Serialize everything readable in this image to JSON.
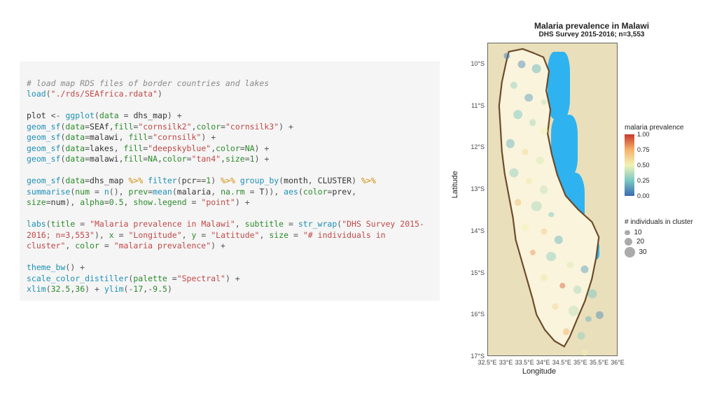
{
  "code": {
    "comment1": "# load map RDS files of border countries and lakes",
    "load_path": "\"./rds/SEAfrica.rdata\"",
    "lines": {
      "l1": "load",
      "l2_plot": "plot",
      "l2_gg": "ggplot",
      "l2_data": "data",
      "l2_dhs": "dhs_map",
      "geom_sf": "geom_sf",
      "data_arg": "data",
      "fill_arg": "fill",
      "color_arg": "color",
      "size_arg": "size",
      "v_SEAf": "SEAf",
      "v_malawi": "malawi",
      "v_lakes": "lakes",
      "s_cornsilk2": "\"cornsilk2\"",
      "s_cornsilk3": "\"cornsilk3\"",
      "s_cornsilk": "\"cornsilk\"",
      "s_deepskyblue": "\"deepskyblue\"",
      "s_tan4": "\"tan4\"",
      "na": "NA",
      "num1": "1",
      "pipe": "%>%",
      "filter": "filter",
      "pcr": "pcr",
      "eq1": "1",
      "group_by": "group_by",
      "month": "month",
      "cluster": "CLUSTER",
      "summarise": "summarise",
      "num_eq": "num",
      "n_fn": "n",
      "prev": "prev",
      "mean": "mean",
      "malaria": "malaria",
      "narm": "na.rm",
      "T": "T",
      "aes": "aes",
      "colorprev": "color",
      "sizeeq": "size",
      "alpha": "alpha",
      "alpha_v": "0.5",
      "showlegend": "show.legend",
      "point": "\"point\"",
      "labs": "labs",
      "title_arg": "title",
      "title_str": "\"Malaria prevalence in Malawi\"",
      "subtitle_arg": "subtitle",
      "str_wrap": "str_wrap",
      "subtitle_str": "\"DHS Survey 2015-2016; n=3,553\"",
      "x_arg": "x",
      "x_str": "\"Longitude\"",
      "y_arg": "y",
      "y_str": "\"Latitude\"",
      "size_lab": "\"# individuals in cluster\"",
      "color_lab": "\"malaria prevalence\"",
      "theme_bw": "theme_bw",
      "scale_color": "scale_color_distiller",
      "palette": "palette",
      "spectral": "\"Spectral\"",
      "xlim": "xlim",
      "xlim_a": "32.5",
      "xlim_b": "36",
      "ylim": "ylim",
      "ylim_a": "-17",
      "ylim_b": "-9.5"
    }
  },
  "chart_data": {
    "type": "map",
    "title": "Malaria prevalence in Malawi",
    "subtitle": "DHS Survey 2015-2016; n=3,553",
    "xlabel": "Longitude",
    "ylabel": "Latitude",
    "xlim": [
      32.5,
      36.0
    ],
    "ylim": [
      -17.0,
      -9.5
    ],
    "xticks": [
      "32.5°E",
      "33°E",
      "33.5°E",
      "34°E",
      "34.5°E",
      "35°E",
      "35.5°E",
      "36°E"
    ],
    "yticks": [
      "10°S",
      "11°S",
      "12°S",
      "13°S",
      "14°S",
      "15°S",
      "16°S",
      "17°S"
    ],
    "color_legend": {
      "title": "malaria prevalence",
      "breaks": [
        0.0,
        0.25,
        0.5,
        0.75,
        1.0
      ],
      "palette": "Spectral"
    },
    "size_legend": {
      "title": "# individuals in cluster",
      "breaks": [
        10,
        20,
        30
      ]
    },
    "lake_rects": [
      {
        "x": 34.1,
        "y": -9.7,
        "w": 0.6,
        "h": 1.6
      },
      {
        "x": 34.2,
        "y": -11.2,
        "w": 0.7,
        "h": 1.5
      },
      {
        "x": 34.3,
        "y": -12.6,
        "w": 0.8,
        "h": 1.6
      },
      {
        "x": 34.5,
        "y": -14.0,
        "w": 0.7,
        "h": 0.8
      },
      {
        "x": 34.9,
        "y": -14.2,
        "w": 0.6,
        "h": 0.5
      }
    ],
    "points": [
      {
        "lon": 33.0,
        "lat": -9.8,
        "prev": 0.05,
        "n": 15
      },
      {
        "lon": 33.4,
        "lat": -10.0,
        "prev": 0.1,
        "n": 20
      },
      {
        "lon": 33.8,
        "lat": -10.1,
        "prev": 0.2,
        "n": 25
      },
      {
        "lon": 33.2,
        "lat": -10.5,
        "prev": 0.3,
        "n": 18
      },
      {
        "lon": 33.6,
        "lat": -10.8,
        "prev": 0.15,
        "n": 22
      },
      {
        "lon": 34.0,
        "lat": -10.9,
        "prev": 0.4,
        "n": 12
      },
      {
        "lon": 33.3,
        "lat": -11.2,
        "prev": 0.25,
        "n": 28
      },
      {
        "lon": 33.7,
        "lat": -11.4,
        "prev": 0.35,
        "n": 16
      },
      {
        "lon": 34.0,
        "lat": -11.6,
        "prev": 0.5,
        "n": 20
      },
      {
        "lon": 33.1,
        "lat": -11.9,
        "prev": 0.2,
        "n": 24
      },
      {
        "lon": 33.5,
        "lat": -12.1,
        "prev": 0.6,
        "n": 14
      },
      {
        "lon": 33.9,
        "lat": -12.3,
        "prev": 0.45,
        "n": 18
      },
      {
        "lon": 33.2,
        "lat": -12.6,
        "prev": 0.3,
        "n": 26
      },
      {
        "lon": 33.6,
        "lat": -12.8,
        "prev": 0.55,
        "n": 12
      },
      {
        "lon": 34.0,
        "lat": -13.0,
        "prev": 0.4,
        "n": 22
      },
      {
        "lon": 33.3,
        "lat": -13.3,
        "prev": 0.7,
        "n": 16
      },
      {
        "lon": 33.8,
        "lat": -13.4,
        "prev": 0.35,
        "n": 30
      },
      {
        "lon": 34.2,
        "lat": -13.6,
        "prev": 0.25,
        "n": 10
      },
      {
        "lon": 33.5,
        "lat": -13.9,
        "prev": 0.5,
        "n": 20
      },
      {
        "lon": 34.0,
        "lat": -14.0,
        "prev": 0.65,
        "n": 14
      },
      {
        "lon": 34.4,
        "lat": -14.2,
        "prev": 0.2,
        "n": 24
      },
      {
        "lon": 33.7,
        "lat": -14.5,
        "prev": 0.8,
        "n": 12
      },
      {
        "lon": 34.2,
        "lat": -14.6,
        "prev": 0.3,
        "n": 28
      },
      {
        "lon": 34.7,
        "lat": -14.8,
        "prev": 0.45,
        "n": 16
      },
      {
        "lon": 35.1,
        "lat": -14.9,
        "prev": 0.15,
        "n": 20
      },
      {
        "lon": 34.0,
        "lat": -15.1,
        "prev": 0.55,
        "n": 18
      },
      {
        "lon": 34.5,
        "lat": -15.3,
        "prev": 0.9,
        "n": 10
      },
      {
        "lon": 34.9,
        "lat": -15.4,
        "prev": 0.35,
        "n": 22
      },
      {
        "lon": 35.3,
        "lat": -15.5,
        "prev": 0.25,
        "n": 26
      },
      {
        "lon": 34.3,
        "lat": -15.8,
        "prev": 0.6,
        "n": 14
      },
      {
        "lon": 34.8,
        "lat": -15.9,
        "prev": 0.4,
        "n": 30
      },
      {
        "lon": 35.2,
        "lat": -16.1,
        "prev": 0.2,
        "n": 12
      },
      {
        "lon": 35.5,
        "lat": -16.0,
        "prev": 0.1,
        "n": 18
      },
      {
        "lon": 34.6,
        "lat": -16.4,
        "prev": 0.75,
        "n": 16
      },
      {
        "lon": 35.0,
        "lat": -16.5,
        "prev": 0.3,
        "n": 20
      },
      {
        "lon": 35.1,
        "lat": -16.9,
        "prev": 0.5,
        "n": 14
      }
    ]
  }
}
